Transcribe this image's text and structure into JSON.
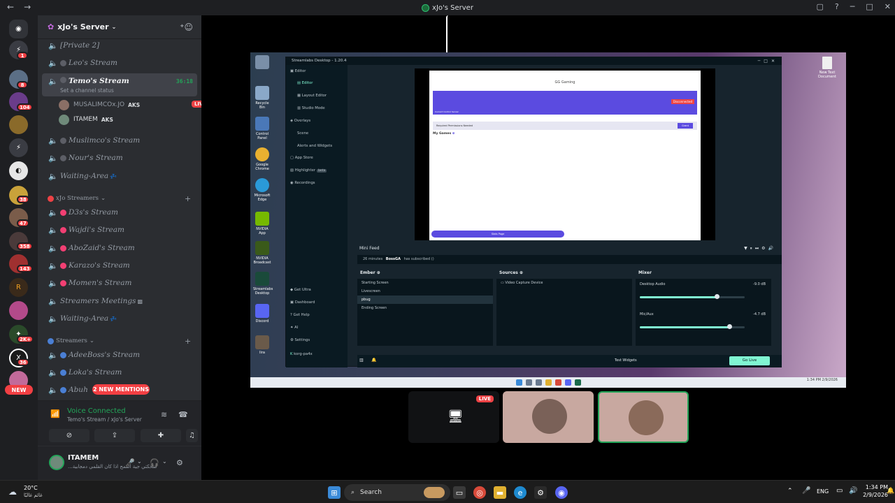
{
  "titlebar": {
    "server_name": "xJo's Server"
  },
  "rail": {
    "badges": [
      "1",
      "8",
      "104",
      "38",
      "47",
      "358",
      "143",
      "2K+",
      "36",
      "51"
    ],
    "new_label": "NEW"
  },
  "sidebar": {
    "server_title": "xJo's Server",
    "channels_top": [
      {
        "name": "[Private 2]"
      },
      {
        "name": "Leo's Stream"
      },
      {
        "name": "Temo's Stream",
        "timer": "36:18",
        "status": "Set a channel status"
      }
    ],
    "members": [
      {
        "name": "MUSALIMCOx.JO",
        "tag": "AKS",
        "live": "LIVE"
      },
      {
        "name": "ITAMEM",
        "tag": "AKS"
      }
    ],
    "channels_mid": [
      {
        "name": "Muslimco's Stream"
      },
      {
        "name": "Nour's Stream"
      },
      {
        "name": "Waiting-Area"
      }
    ],
    "category1": "xJo Streamers",
    "channels_cat1": [
      {
        "name": "D3s's Stream"
      },
      {
        "name": "Wajdi's Stream"
      },
      {
        "name": "AboZaid's Stream"
      },
      {
        "name": "Karazo's Stream"
      },
      {
        "name": "Momen's Stream"
      },
      {
        "name": "Streamers Meetings"
      },
      {
        "name": "Waiting-Area"
      }
    ],
    "category2": "Streamers",
    "channels_cat2": [
      {
        "name": "AdeeBoss's Stream"
      },
      {
        "name": "Loka's Stream"
      },
      {
        "name": "Abuh"
      }
    ],
    "mentions": "2 NEW MENTIONS",
    "voice": {
      "status": "Voice Connected",
      "sub": "Temo's Stream / xJo's Server"
    },
    "user": {
      "name": "ITAMEM",
      "status": "...ضحكتي جية القمح اذا كان القلمي دمجابية"
    }
  },
  "streamlabs": {
    "title": "Streamlabs Desktop - 1.20.4",
    "nav": [
      "Editor",
      "Editor",
      "Layout Editor",
      "Studio Mode",
      "Overlays",
      "Scene",
      "Alerts and Widgets",
      "App Store",
      "Highlighter",
      "Recordings"
    ],
    "beta": "beta",
    "nav_bottom": [
      "Get Ultra",
      "Dashboard",
      "Get Help",
      "AI",
      "Settings",
      "korg-pa4x"
    ],
    "preview": {
      "page_title": "GG Gaming",
      "disconnected": "Disconnected",
      "band_label": "Current Control Server",
      "required": "Required Permissions Needed",
      "grant": "Grant",
      "my_games": "My Games",
      "stats": "Stats Page"
    },
    "minifeed": {
      "title": "Mini Feed",
      "time": "26 minutes",
      "user": "BossGA",
      "event": "has subscribed ()"
    },
    "scenes_title": "Ember",
    "scenes": [
      "Starting Screen",
      "Livescreen",
      "pbug",
      "Ending Screen"
    ],
    "sources_title": "Sources",
    "sources": [
      "Video Capture Device"
    ],
    "mixer_title": "Mixer",
    "mixer": [
      {
        "name": "Desktop Audio",
        "db": "-9.0 dB",
        "level": 0.73
      },
      {
        "name": "Mic/Aux",
        "db": "-4.7 dB",
        "level": 0.85
      }
    ],
    "test_widgets": "Test Widgets",
    "go_live": "Go Live"
  },
  "desktop": {
    "icons": [
      "Recycle Bin",
      "Control Panel",
      "Google Chrome",
      "Microsoft Edge",
      "NVIDIA App",
      "NVIDIA Broadcast",
      "Streamlabs Desktop",
      "Discord",
      "lira"
    ],
    "new_doc": "New Text Document",
    "clock": "1:34 PM\n2/9/2026"
  },
  "tiles": {
    "live": "LIVE"
  },
  "taskbar": {
    "temp": "20°C",
    "condition": "غائم غالبًا",
    "search": "Search",
    "lang": "ENG",
    "time": "1:34 PM",
    "date": "2/9/2026"
  }
}
